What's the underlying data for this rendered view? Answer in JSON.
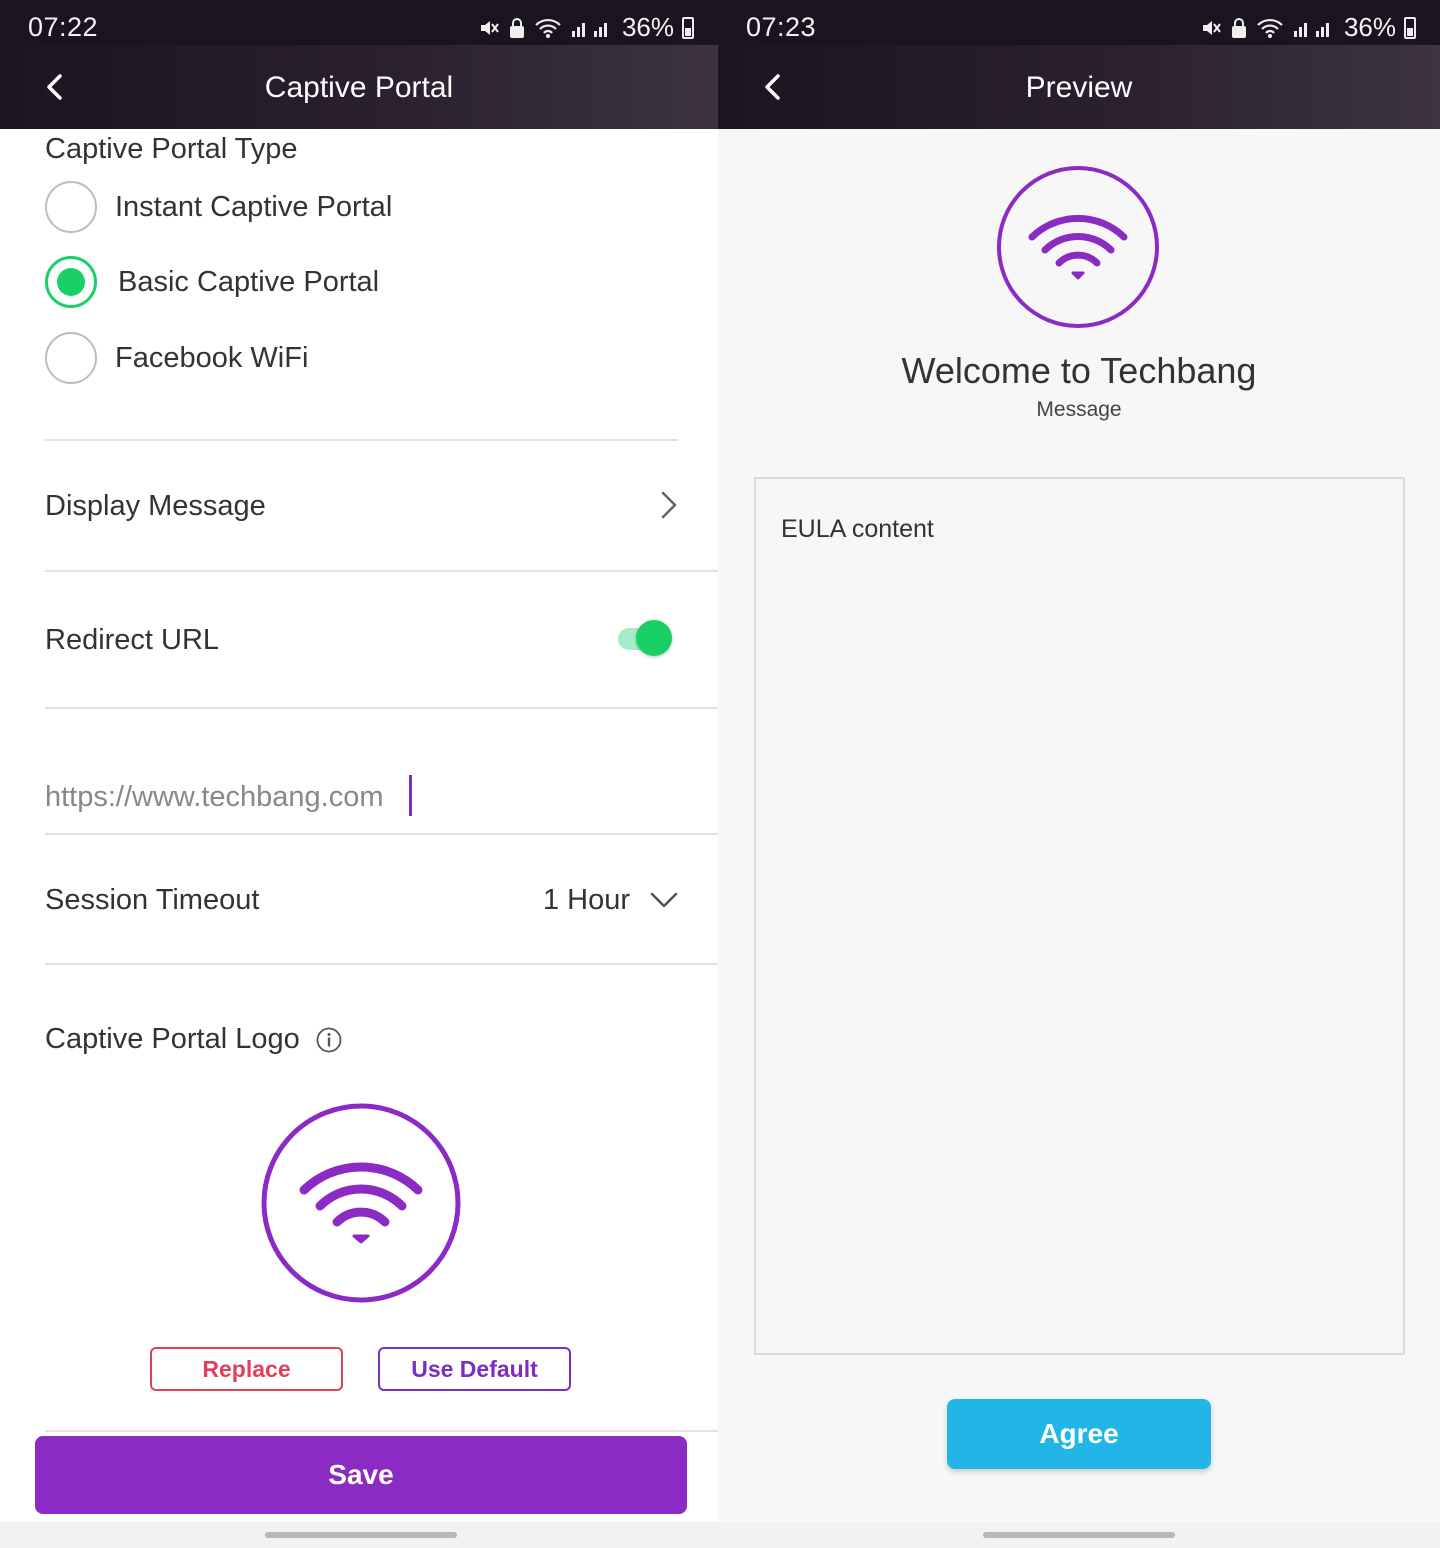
{
  "left": {
    "status": {
      "time": "07:22",
      "battery": "36%"
    },
    "appbar": {
      "title": "Captive Portal"
    },
    "type_section": {
      "title": "Captive Portal Type",
      "options": [
        {
          "label": "Instant Captive Portal",
          "selected": false
        },
        {
          "label": "Basic Captive Portal",
          "selected": true
        },
        {
          "label": "Facebook WiFi",
          "selected": false
        }
      ]
    },
    "display_message": {
      "label": "Display Message"
    },
    "redirect": {
      "label": "Redirect URL",
      "enabled": true,
      "url_value": "https://www.techbang.com"
    },
    "session_timeout": {
      "label": "Session Timeout",
      "value": "1 Hour"
    },
    "logo_section": {
      "label": "Captive Portal Logo",
      "icon": "info-icon"
    },
    "buttons": {
      "replace": "Replace",
      "use_default": "Use Default",
      "save": "Save"
    }
  },
  "right": {
    "status": {
      "time": "07:23",
      "battery": "36%"
    },
    "appbar": {
      "title": "Preview"
    },
    "welcome": "Welcome to Techbang",
    "message": "Message",
    "eula": "EULA content",
    "agree": "Agree"
  },
  "colors": {
    "accent_purple": "#8b2bc4",
    "radio_green": "#18d065",
    "agree_blue": "#21b6e6",
    "replace_red": "#e0405a",
    "header_dark": "#1c1420"
  }
}
